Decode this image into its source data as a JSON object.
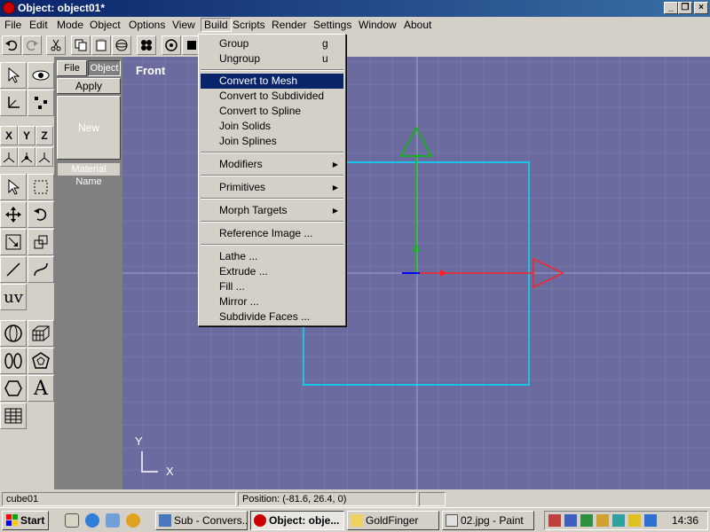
{
  "window": {
    "title": "Object: object01*"
  },
  "menubar": {
    "items": [
      "File",
      "Edit",
      "Mode",
      "Object",
      "Options",
      "View",
      "Build",
      "Scripts",
      "Render",
      "Settings",
      "Window",
      "About"
    ],
    "open": "Build"
  },
  "panel": {
    "tab_file": "File",
    "tab_object": "Object",
    "apply": "Apply",
    "new": "New",
    "material_name": "Material Name"
  },
  "toolbox": {
    "uv_label": "uv",
    "text_tool_label": "A",
    "axis_x": "X",
    "axis_y": "Y",
    "axis_z": "Z"
  },
  "viewport": {
    "label": "Front",
    "axis_y": "Y",
    "axis_x": "X"
  },
  "build_menu": {
    "items": [
      {
        "label": "Group",
        "shortcut": "g"
      },
      {
        "label": "Ungroup",
        "shortcut": "u"
      },
      {
        "label": "Convert to Mesh",
        "highlighted": true
      },
      {
        "label": "Convert to Subdivided"
      },
      {
        "label": "Convert to Spline"
      },
      {
        "label": "Join Solids"
      },
      {
        "label": "Join Splines"
      },
      {
        "label": "Modifiers",
        "submenu": true
      },
      {
        "label": "Primitives",
        "submenu": true
      },
      {
        "label": "Morph Targets",
        "submenu": true
      },
      {
        "label": "Reference Image ..."
      },
      {
        "label": "Lathe ..."
      },
      {
        "label": "Extrude ..."
      },
      {
        "label": "Fill ..."
      },
      {
        "label": "Mirror ..."
      },
      {
        "label": "Subdivide Faces ..."
      }
    ]
  },
  "statusbar": {
    "object_name": "cube01",
    "position": "Position: (-81.6, 26.4, 0)"
  },
  "taskbar": {
    "start": "Start",
    "tasks": [
      "Sub - Convers...",
      "Object: obje...",
      "GoldFinger",
      "02.jpg - Paint"
    ],
    "clock": "14:36"
  },
  "colors": {
    "viewport_bg": "#6b6b9f",
    "grid": "#8080a8",
    "menu_highlight": "#0a246a",
    "cube_outline": "#00e0ff",
    "axis_y": "#00c000",
    "axis_x": "#ff2020",
    "titlebar": "#0a246a"
  }
}
